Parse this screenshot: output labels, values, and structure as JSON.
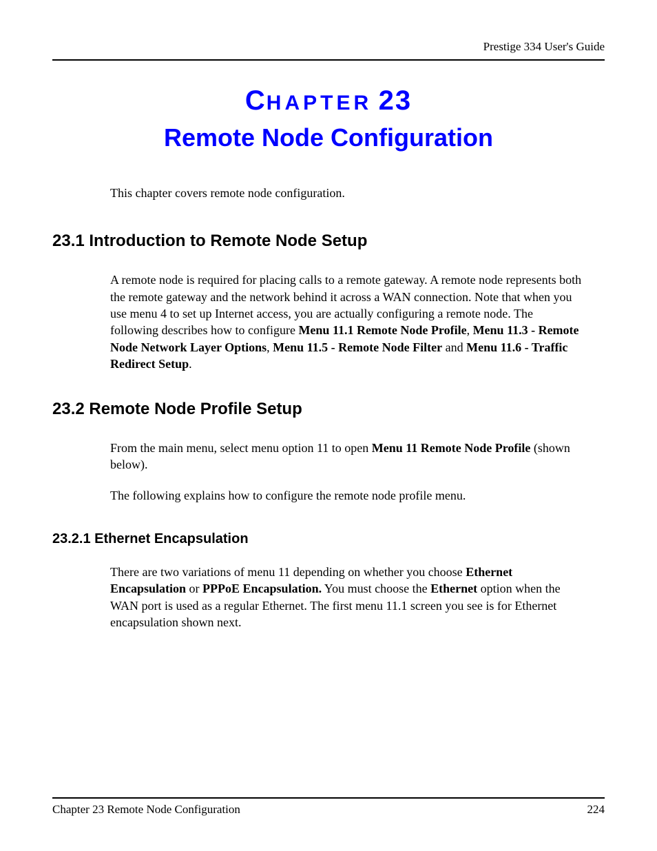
{
  "header": {
    "guide": "Prestige 334 User's Guide"
  },
  "chapter": {
    "small_prefix": "C",
    "small_rest": "HAPTER",
    "number": "23",
    "title": "Remote Node Configuration"
  },
  "intro": "This chapter covers remote node configuration.",
  "sections": {
    "s1": {
      "heading": "23.1  Introduction to Remote Node Setup",
      "p1_pre": "A remote node is required for placing calls to a remote gateway. A remote node represents both the remote gateway and the network behind it across a WAN connection. Note that when you use menu 4 to set up Internet access, you are actually configuring a remote node. The following describes how to configure ",
      "p1_b1": "Menu 11.1 Remote Node Profile",
      "p1_c1": ", ",
      "p1_b2": "Menu 11.3 - Remote Node Network Layer Options",
      "p1_c2": ", ",
      "p1_b3": "Menu 11.5 - Remote Node Filter",
      "p1_c3": " and ",
      "p1_b4": "Menu 11.6 - Traffic Redirect Setup",
      "p1_c4": "."
    },
    "s2": {
      "heading": "23.2  Remote Node Profile Setup",
      "p1_pre": "From the main menu, select menu option 11 to open ",
      "p1_b1": "Menu 11 Remote Node Profile",
      "p1_post": " (shown below).",
      "p2": "The following explains how to configure the remote node profile menu."
    },
    "s2_1": {
      "heading": "23.2.1  Ethernet Encapsulation",
      "p1_pre": "There are two variations of menu 11 depending on whether you choose ",
      "p1_b1": "Ethernet Encapsulation",
      "p1_c1": " or ",
      "p1_b2": "PPPoE Encapsulation.",
      "p1_c2": " You must choose the ",
      "p1_b3": "Ethernet",
      "p1_post": " option when the WAN port is used as a regular Ethernet. The first menu 11.1 screen you see is for Ethernet encapsulation shown next."
    }
  },
  "footer": {
    "left": "Chapter 23 Remote Node Configuration",
    "right": "224"
  }
}
